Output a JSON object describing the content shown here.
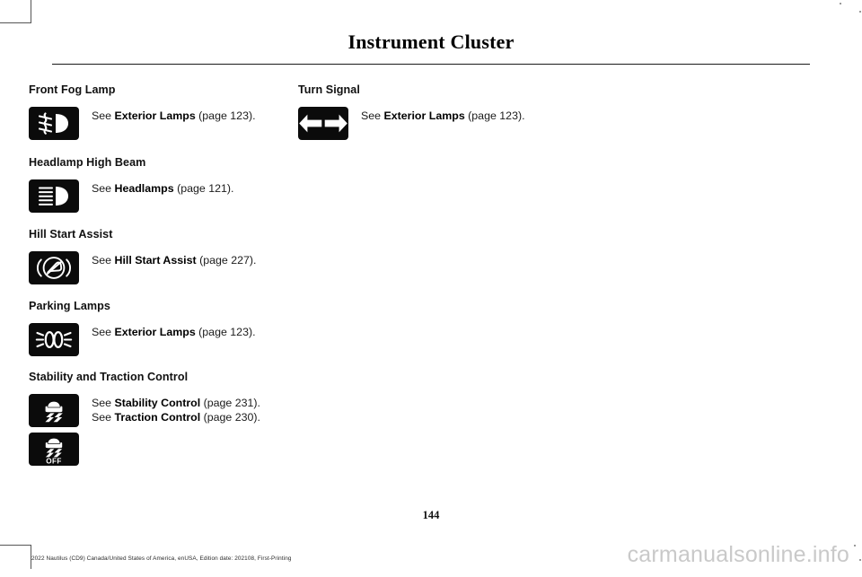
{
  "document": {
    "page_title": "Instrument Cluster",
    "page_number": "144",
    "legal_line": "2022 Nautilus (CD9) Canada/United States of America, enUSA, Edition date: 202108, First-Printing",
    "watermark": "carmanualsonline.info"
  },
  "columns": {
    "left": [
      {
        "heading": "Front Fog Lamp",
        "icons": [
          "front-fog-lamp-telltale"
        ],
        "lines": [
          {
            "prefix": "See ",
            "link": "Exterior Lamps",
            "suffix": " (page 123)."
          }
        ]
      },
      {
        "heading": "Headlamp High Beam",
        "icons": [
          "headlamp-high-beam-telltale"
        ],
        "lines": [
          {
            "prefix": "See ",
            "link": "Headlamps",
            "suffix": " (page 121)."
          }
        ]
      },
      {
        "heading": "Hill Start Assist",
        "icons": [
          "hill-start-assist-telltale"
        ],
        "lines": [
          {
            "prefix": "See ",
            "link": "Hill Start Assist",
            "suffix": " (page 227)."
          }
        ]
      },
      {
        "heading": "Parking Lamps",
        "icons": [
          "parking-lamps-telltale"
        ],
        "lines": [
          {
            "prefix": "See ",
            "link": "Exterior Lamps",
            "suffix": " (page 123)."
          }
        ]
      },
      {
        "heading": "Stability and Traction Control",
        "icons": [
          "stability-control-telltale",
          "stability-control-off-telltale"
        ],
        "lines": [
          {
            "prefix": "See ",
            "link": "Stability Control",
            "suffix": " (page 231)."
          },
          {
            "prefix": "See ",
            "link": "Traction Control",
            "suffix": " (page 230)."
          }
        ]
      }
    ],
    "right": [
      {
        "heading": "Turn Signal",
        "icons": [
          "turn-signal-telltale"
        ],
        "lines": [
          {
            "prefix": "See ",
            "link": "Exterior Lamps",
            "suffix": " (page 123)."
          }
        ]
      }
    ]
  },
  "icon_labels": {
    "stability_off_text": "OFF"
  },
  "colors": {
    "tile_background": "#0b0b0b",
    "tile_glyph": "#ffffff",
    "text": "#1b1b1b",
    "rule": "#1a1a1a",
    "watermark": "#c9c9c9"
  }
}
